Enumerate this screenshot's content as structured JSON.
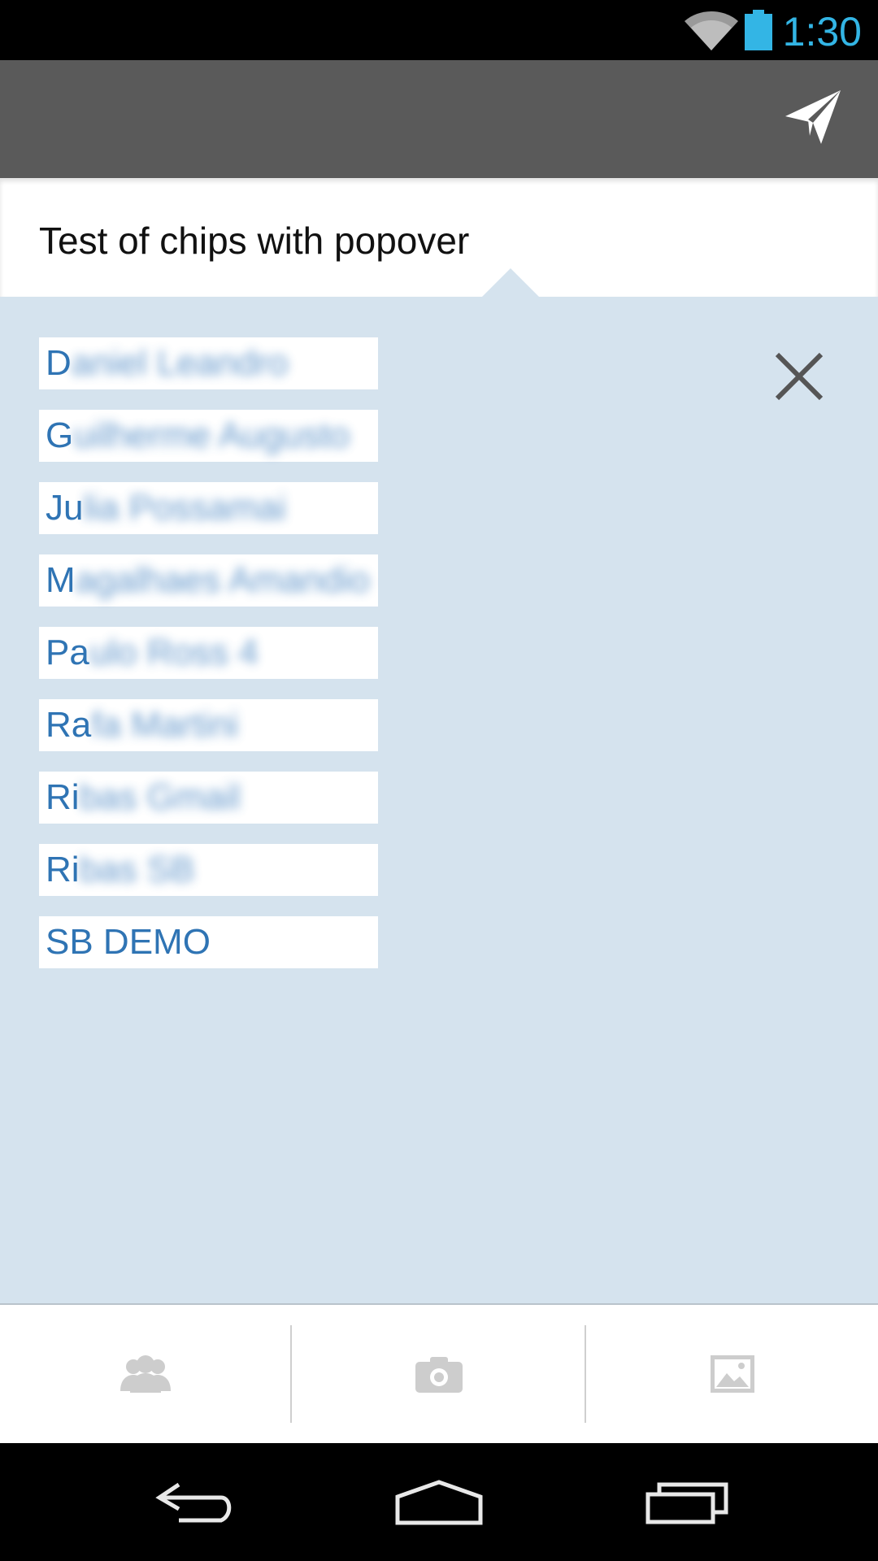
{
  "status_bar": {
    "time": "1:30",
    "icons": [
      "wifi-icon",
      "battery-icon"
    ],
    "time_color": "#33b5e5"
  },
  "action_bar": {
    "background": "#5a5a5a",
    "actions": [
      {
        "icon": "send-icon"
      }
    ]
  },
  "compose": {
    "title": "Test of chips with popover"
  },
  "popover": {
    "background": "#d5e3ee",
    "chips": [
      {
        "visible": "D",
        "hidden": "aniel Leandro"
      },
      {
        "visible": "G",
        "hidden": "uilherme Augusto"
      },
      {
        "visible": "Ju",
        "hidden": "lia Possamai"
      },
      {
        "visible": "M",
        "hidden": "agalhaes Amandio"
      },
      {
        "visible": "Pa",
        "hidden": "ulo Ross 4"
      },
      {
        "visible": "Ra",
        "hidden": "fa Martini"
      },
      {
        "visible": "Ri",
        "hidden": "bas Gmail"
      },
      {
        "visible": "Ri",
        "hidden": "bas SB"
      },
      {
        "visible": "SB DEMO",
        "hidden": ""
      }
    ],
    "chip_text_color": "#2f74b4",
    "close_icon": "close-icon"
  },
  "bottom_bar": {
    "buttons": [
      "contacts-icon",
      "camera-icon",
      "image-icon"
    ]
  },
  "nav_bar": {
    "buttons": [
      "back-icon",
      "home-icon",
      "recent-apps-icon"
    ]
  }
}
